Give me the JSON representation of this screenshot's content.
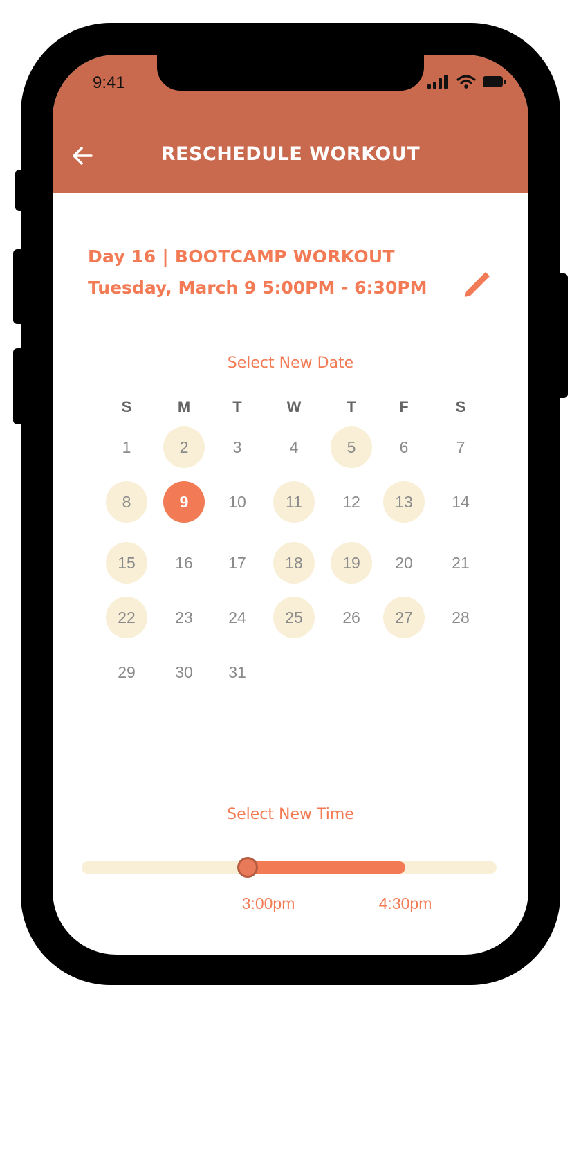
{
  "status_bar": {
    "time": "9:41"
  },
  "header": {
    "title": "RESCHEDULE WORKOUT"
  },
  "workout": {
    "title": "Day 16 | BOOTCAMP WORKOUT",
    "time": "Tuesday, March 9 5:00PM - 6:30PM"
  },
  "date_section": {
    "label": "Select New Date"
  },
  "calendar": {
    "weekdays": [
      "S",
      "M",
      "T",
      "W",
      "T",
      "F",
      "S"
    ],
    "first_weekday_index": 0,
    "days_in_month": 31,
    "selected_day": 9,
    "available_days": [
      2,
      5,
      8,
      11,
      13,
      15,
      18,
      19,
      22,
      25,
      27
    ]
  },
  "time_section": {
    "label": "Select New Time",
    "start_label": "3:00pm",
    "end_label": "4:30pm",
    "range_start": 0.4,
    "range_end": 0.78
  },
  "colors": {
    "header": "#c96a4e",
    "accent": "#f27b55",
    "available_bg": "#f8efd6"
  },
  "icons": {
    "back": "arrow-left-icon",
    "edit": "pencil-icon",
    "signal": "signal-icon",
    "wifi": "wifi-icon",
    "battery": "battery-icon"
  }
}
